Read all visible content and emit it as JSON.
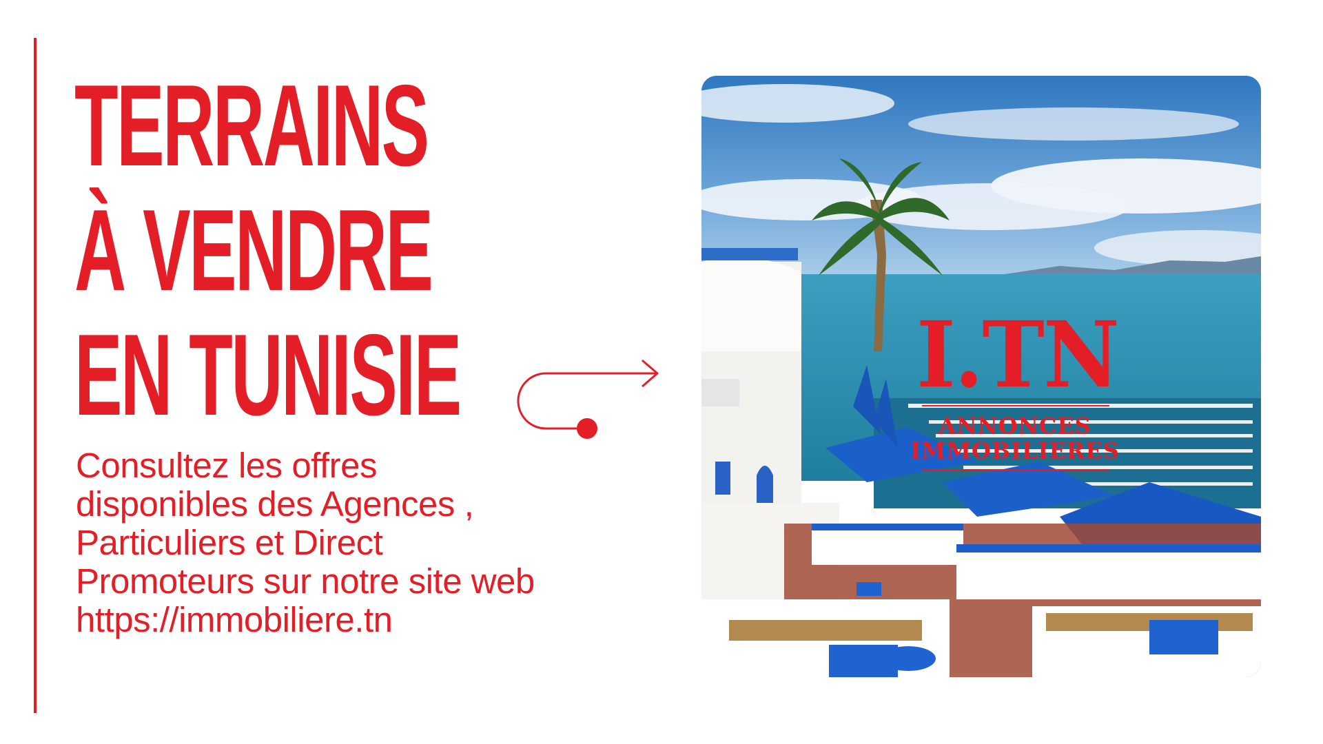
{
  "headline": {
    "line1": "TERRAINS",
    "line2": "À VENDRE",
    "line3": "EN TUNISIE"
  },
  "description": {
    "line1": "Consultez les offres",
    "line2": "disponibles des Agences ,",
    "line3": "Particuliers et Direct",
    "line4": "Promoteurs sur notre site web",
    "line5": "https://immobiliere.tn"
  },
  "logo": {
    "mark": "I.TN",
    "line1": "ANNONCES",
    "line2": "IMMOBILIERES"
  },
  "colors": {
    "accent": "#e41e26",
    "background": "#ffffff",
    "sea": "#2a97b8",
    "sky": "#3f86c9",
    "umbrella_blue": "#1b5fc8"
  },
  "icons": {
    "arrow": "curved-arrow-right-icon",
    "photo": "sidi-bou-said-photo"
  }
}
